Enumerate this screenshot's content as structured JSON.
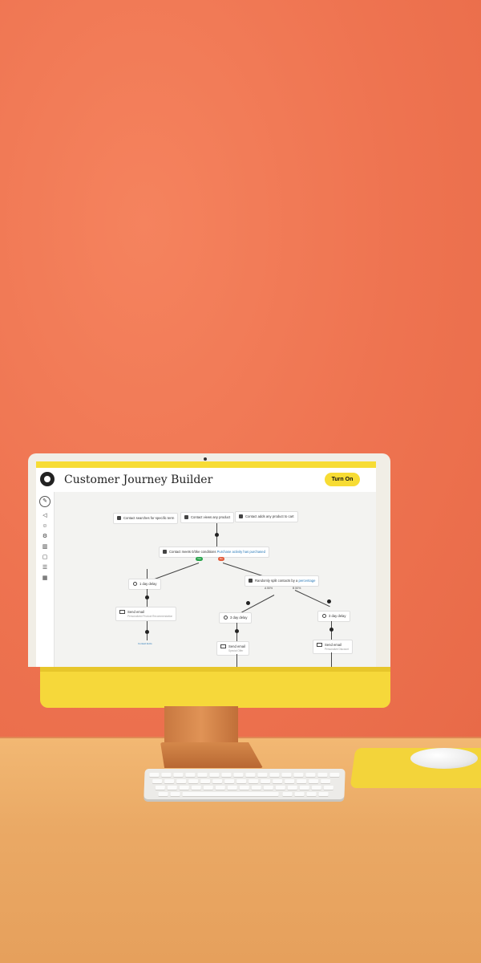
{
  "app": {
    "title": "Customer Journey Builder",
    "turn_on_label": "Turn On"
  },
  "colors": {
    "accent": "#f7dc34",
    "wall": "#ee7350",
    "desk": "#eaa965",
    "link": "#2a7ab8",
    "yes": "#27a44a",
    "no": "#e25b3b"
  },
  "sidebar": {
    "items": [
      "pencil-icon",
      "megaphone-icon",
      "contacts-icon",
      "automations-icon",
      "analytics-icon",
      "website-icon",
      "settings-icon",
      "apps-icon"
    ]
  },
  "journey": {
    "triggers": [
      "Contact searches for specific term",
      "Contact views any product",
      "Contact adds any product to cart"
    ],
    "condition_prefix": "Contact meets 0/3ke conditions",
    "condition_link": "Purchase activity has purchased",
    "yes_label": "Yes",
    "no_label": "No",
    "delay_left": "1 day delay",
    "split_prefix": "Randomly split contacts by a",
    "split_link": "percentage",
    "split_a": "A 50%",
    "split_b": "B 50%",
    "delay_mid": "3 day delay",
    "delay_right": "3 day delay",
    "email_left_title": "Send email",
    "email_left_sub": "Personalized Product Recommendation",
    "email_mid_title": "Send email",
    "email_mid_sub": "Special Offer",
    "email_right_title": "Send email",
    "email_right_sub": "Personalize Discount",
    "add_step": "Contact Exits"
  }
}
